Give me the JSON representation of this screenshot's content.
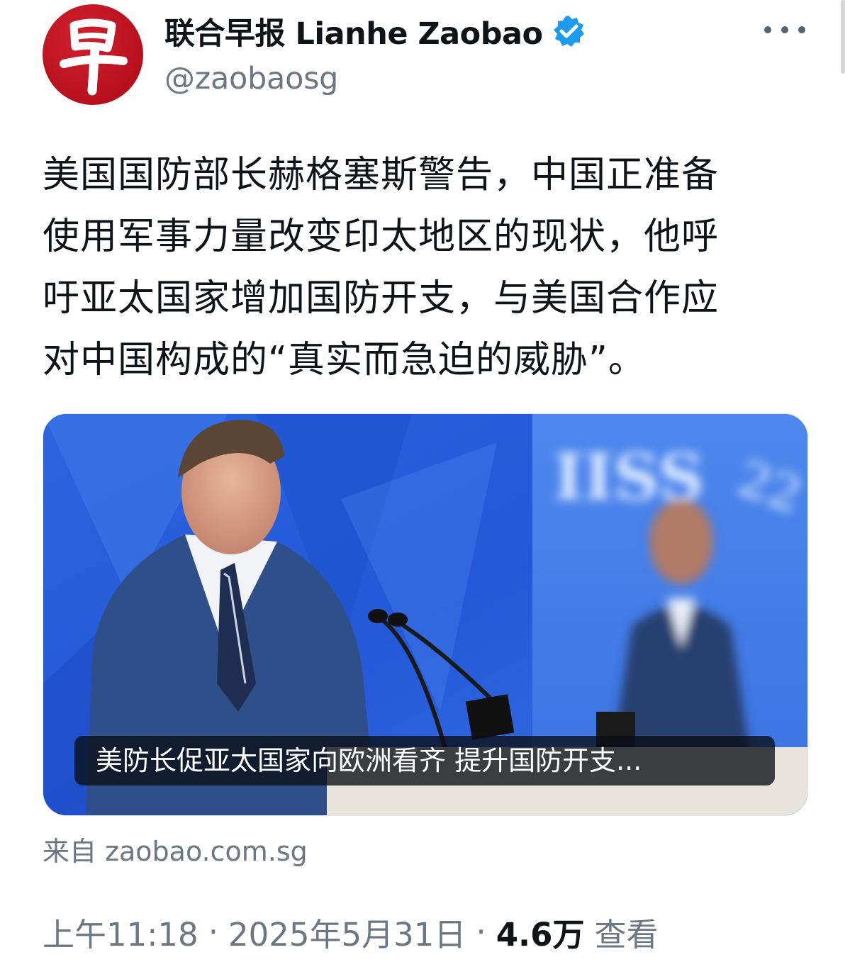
{
  "account": {
    "display_name": "联合早报 Lianhe Zaobao",
    "handle": "@zaobaosg",
    "avatar_glyph": "早",
    "avatar_icon": "zaobao-logo",
    "verified_icon": "verified-badge-icon",
    "more_icon": "more-horizontal-icon"
  },
  "tweet": {
    "lines": [
      "美国国防部长赫格塞斯警告，中国正准备",
      "使用军事力量改变印太地区的现状，他呼",
      "吁亚太国家增加国防开支，与美国合作应",
      "对中国构成的“真实而急迫的威胁”。"
    ]
  },
  "card": {
    "caption": "美防长促亚太国家向欧洲看齐 提升国防开支...",
    "source": "来自 zaobao.com.sg"
  },
  "meta": {
    "time": "上午11:18",
    "separator": "·",
    "date": "2025年5月31日",
    "views_count": "4.6万",
    "views_label": "查看"
  },
  "colors": {
    "text": "#0f1419",
    "secondary": "#6b7782",
    "verified": "#1d9bf0",
    "brand_red": "#c0141f"
  }
}
